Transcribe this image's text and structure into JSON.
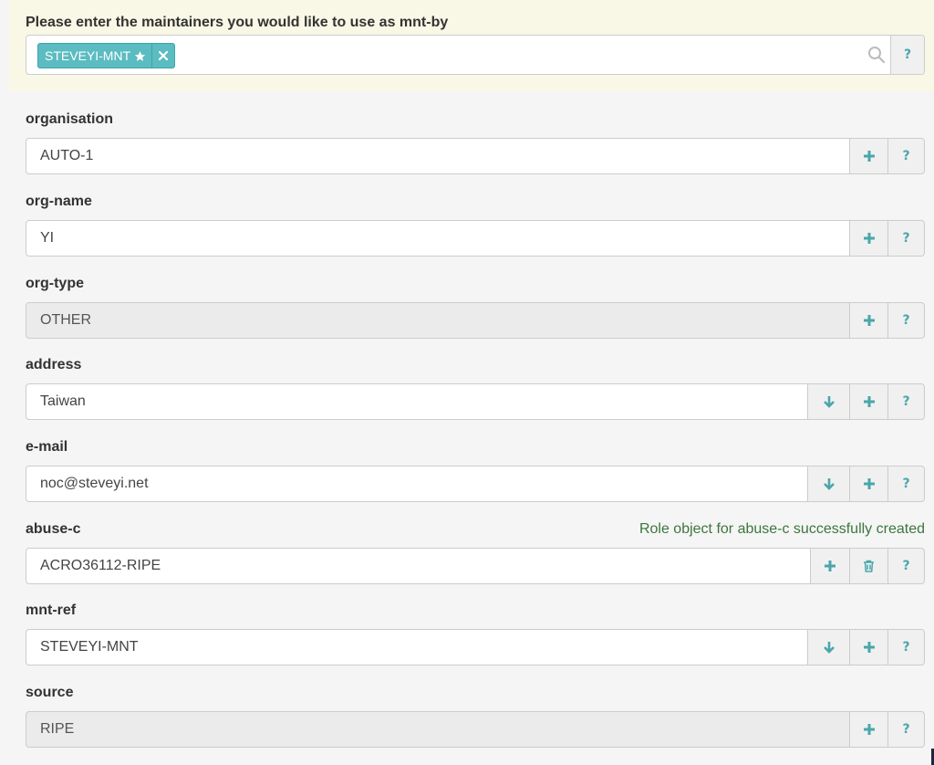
{
  "maintainers": {
    "label": "Please enter the maintainers you would like to use as mnt-by",
    "tag": "STEVEYI-MNT",
    "help": "?"
  },
  "fields": {
    "organisation": {
      "label": "organisation",
      "value": "AUTO-1"
    },
    "org_name": {
      "label": "org-name",
      "value": "YI"
    },
    "org_type": {
      "label": "org-type",
      "value": "OTHER"
    },
    "address": {
      "label": "address",
      "value": "Taiwan"
    },
    "email": {
      "label": "e-mail",
      "value": "noc@steveyi.net"
    },
    "abuse_c": {
      "label": "abuse-c",
      "value": "ACRO36112-RIPE",
      "status": "Role object for abuse-c successfully created"
    },
    "mnt_ref": {
      "label": "mnt-ref",
      "value": "STEVEYI-MNT"
    },
    "source": {
      "label": "source",
      "value": "RIPE"
    }
  },
  "buttons": {
    "help": "?"
  },
  "colors": {
    "accent": "#4aa6ab",
    "tag_bg": "#5bbcc1",
    "success": "#3c763d",
    "top_bg": "#f9f8e6"
  }
}
